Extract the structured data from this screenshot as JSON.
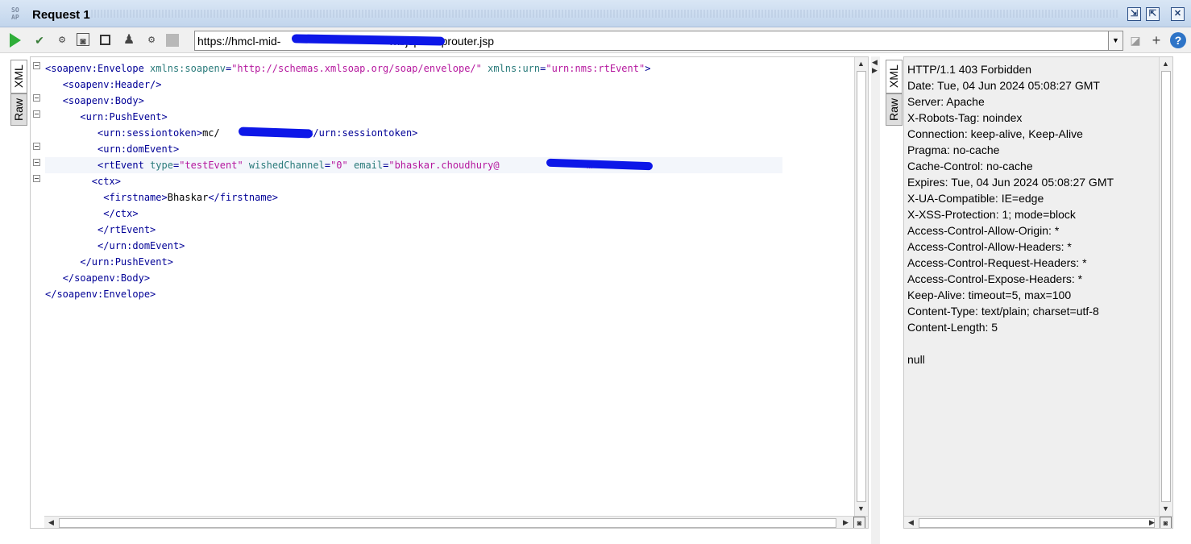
{
  "window": {
    "logo_top": "SO",
    "logo_bottom": "AP",
    "title": "Request 1",
    "controls": [
      "restore",
      "maximize",
      "close"
    ]
  },
  "toolbar": {
    "url": "https://hmcl-mid-                                   /nl/jsp/soaprouter.jsp",
    "url_prefix": "https://hmcl-mid-",
    "url_suffix": "/nl/jsp/soaprouter.jsp",
    "plus_label": "+",
    "help_label": "?"
  },
  "request": {
    "tabs": [
      "XML",
      "Raw"
    ],
    "lines": [
      {
        "indent": 0,
        "parts": [
          [
            "tag",
            "<soapenv:Envelope "
          ],
          [
            "attr",
            "xmlns:soapenv"
          ],
          [
            "tag",
            "="
          ],
          [
            "val",
            "\"http://schemas.xmlsoap.org/soap/envelope/\""
          ],
          [
            "tag",
            " "
          ],
          [
            "attr",
            "xmlns:urn"
          ],
          [
            "tag",
            "="
          ],
          [
            "val",
            "\"urn:nms:rtEvent\""
          ],
          [
            "tag",
            ">"
          ]
        ]
      },
      {
        "indent": 3,
        "parts": [
          [
            "tag",
            "<soapenv:Header/>"
          ]
        ]
      },
      {
        "indent": 3,
        "parts": [
          [
            "tag",
            "<soapenv:Body>"
          ]
        ]
      },
      {
        "indent": 6,
        "parts": [
          [
            "tag",
            "<urn:PushEvent>"
          ]
        ]
      },
      {
        "indent": 9,
        "parts": [
          [
            "tag",
            "<urn:sessiontoken>"
          ],
          [
            "txt",
            "mc/               "
          ],
          [
            "tag",
            "</urn:sessiontoken>"
          ]
        ]
      },
      {
        "indent": 9,
        "parts": [
          [
            "tag",
            "<urn:domEvent>"
          ]
        ]
      },
      {
        "indent": 9,
        "parts": [
          [
            "tag",
            "<rtEvent "
          ],
          [
            "attr",
            "type"
          ],
          [
            "tag",
            "="
          ],
          [
            "val",
            "\"testEvent\""
          ],
          [
            "tag",
            " "
          ],
          [
            "attr",
            "wishedChannel"
          ],
          [
            "tag",
            "="
          ],
          [
            "val",
            "\"0\""
          ],
          [
            "tag",
            " "
          ],
          [
            "attr",
            "email"
          ],
          [
            "tag",
            "="
          ],
          [
            "val",
            "\"bhaskar.choudhury@               m\""
          ],
          [
            "tag",
            ">"
          ]
        ],
        "highlight": true
      },
      {
        "indent": 8,
        "parts": [
          [
            "tag",
            "<ctx>"
          ]
        ]
      },
      {
        "indent": 10,
        "parts": [
          [
            "tag",
            "<firstname>"
          ],
          [
            "txt",
            "Bhaskar"
          ],
          [
            "tag",
            "</firstname>"
          ]
        ]
      },
      {
        "indent": 10,
        "parts": [
          [
            "tag",
            "</ctx>"
          ]
        ]
      },
      {
        "indent": 9,
        "parts": [
          [
            "tag",
            "</rtEvent>"
          ]
        ]
      },
      {
        "indent": 9,
        "parts": [
          [
            "tag",
            "</urn:domEvent>"
          ]
        ]
      },
      {
        "indent": 6,
        "parts": [
          [
            "tag",
            "</urn:PushEvent>"
          ]
        ]
      },
      {
        "indent": 3,
        "parts": [
          [
            "tag",
            "</soapenv:Body>"
          ]
        ]
      },
      {
        "indent": 0,
        "parts": [
          [
            "tag",
            "</soapenv:Envelope>"
          ]
        ]
      }
    ]
  },
  "response": {
    "tabs": [
      "XML",
      "Raw"
    ],
    "lines": [
      "HTTP/1.1 403 Forbidden",
      "Date: Tue, 04 Jun 2024 05:08:27 GMT",
      "Server: Apache",
      "X-Robots-Tag: noindex",
      "Connection: keep-alive, Keep-Alive",
      "Pragma: no-cache",
      "Cache-Control: no-cache",
      "Expires: Tue, 04 Jun 2024 05:08:27 GMT",
      "X-UA-Compatible: IE=edge",
      "X-XSS-Protection: 1; mode=block",
      "Access-Control-Allow-Origin: *",
      "Access-Control-Allow-Headers: *",
      "Access-Control-Request-Headers: *",
      "Access-Control-Expose-Headers: *",
      "Keep-Alive: timeout=5, max=100",
      "Content-Type: text/plain; charset=utf-8",
      "Content-Length: 5",
      "",
      "null"
    ]
  },
  "colors": {
    "tag": "#000096",
    "attr": "#297a7a",
    "value": "#b5179e",
    "run": "#2fae3a",
    "redaction": "#0d17e8"
  }
}
